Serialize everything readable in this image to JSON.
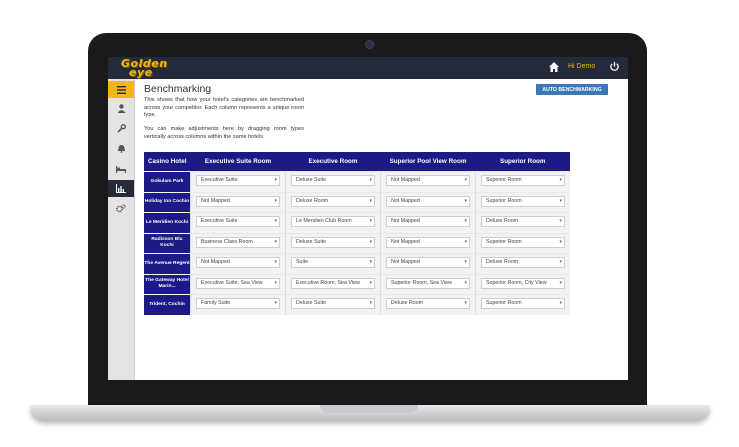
{
  "app": {
    "logo_line1": "Golden",
    "logo_line2": "eye",
    "user": "Hi Demo"
  },
  "page": {
    "title": "Benchmarking",
    "desc1": "This shows that how your hotel's categories are benchmarked across your competitor. Each column represents a unique room type.",
    "desc2": "You can make adjustments here by dragging room types vertically across columns within the same hotels.",
    "auto_button": "AUTO BENCHMARKING"
  },
  "sidebar": [
    "menu-icon",
    "user-icon",
    "wrench-icon",
    "bell-icon",
    "bed-icon",
    "chart-icon",
    "gears-icon"
  ],
  "table": {
    "hotel_header": "Casino Hotel",
    "columns": [
      "Executive Suite Room",
      "Executive Room",
      "Superior Pool View Room",
      "Superior Room"
    ],
    "rows": [
      {
        "hotel": "Gokulam Park",
        "cells": [
          "Executive Suite",
          "Deluxe Suite",
          "Not Mapped",
          "Superior Room"
        ]
      },
      {
        "hotel": "Holiday Inn Cochin",
        "cells": [
          "Not Mapped",
          "Deluxe Room",
          "Not Mapped",
          "Superior Room"
        ]
      },
      {
        "hotel": "Le Meridien Kochi",
        "cells": [
          "Executive Suite",
          "Le Meridien Club Room",
          "Not Mapped",
          "Deluxe Room"
        ]
      },
      {
        "hotel": "Radisson Blu Kochi",
        "cells": [
          "Business Class Room",
          "Deluxe Suite",
          "Not Mapped",
          "Superior Room"
        ]
      },
      {
        "hotel": "The Avenue Regent",
        "cells": [
          "Not Mapped",
          "Suite",
          "Not Mapped",
          "Deluxe Room"
        ]
      },
      {
        "hotel": "The Gateway Hotel Marin...",
        "cells": [
          "Executive Suite, Sea View",
          "Executive Room, Sea View",
          "Superior Room, Sea View",
          "Superior Room, City View"
        ]
      },
      {
        "hotel": "Trident, Cochin",
        "cells": [
          "Family Suite",
          "Deluxe Suite",
          "Deluxe Room",
          "Superior Room"
        ]
      }
    ]
  },
  "colors": {
    "navy": "#1b1a86",
    "topbar": "#252a3a",
    "gold": "#f3b612",
    "button": "#3a78b8"
  }
}
